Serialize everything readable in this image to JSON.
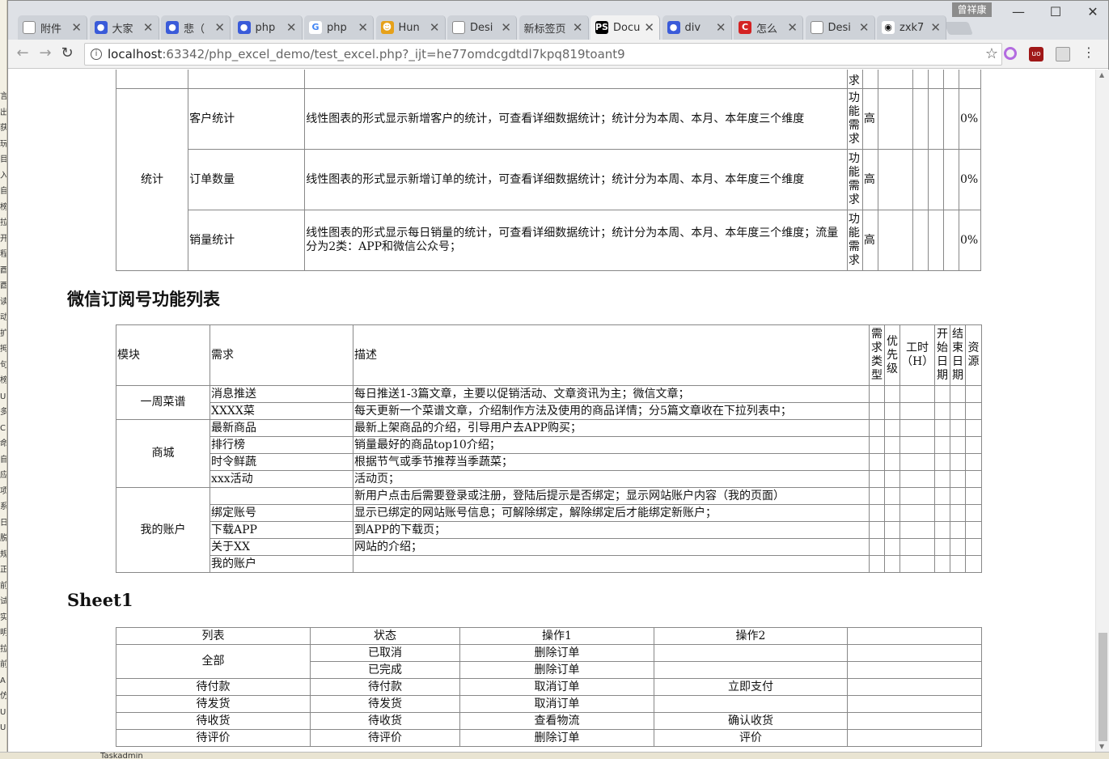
{
  "browser": {
    "user": "曾祥康",
    "tabs": [
      {
        "title": "附件",
        "icon": "file-icon"
      },
      {
        "title": "大家",
        "icon": "paw-icon"
      },
      {
        "title": "悲（",
        "icon": "paw-icon"
      },
      {
        "title": "php",
        "icon": "paw-icon"
      },
      {
        "title": "php",
        "icon": "google-icon"
      },
      {
        "title": "Hun",
        "icon": "hun-icon"
      },
      {
        "title": "Desi",
        "icon": "file-icon"
      },
      {
        "title": "新标签页",
        "icon": "none"
      },
      {
        "title": "Docu",
        "icon": "phpstorm-icon",
        "active": true
      },
      {
        "title": "div",
        "icon": "paw-icon"
      },
      {
        "title": "怎么",
        "icon": "c-icon"
      },
      {
        "title": "Desi",
        "icon": "file-icon"
      },
      {
        "title": "zxk7",
        "icon": "github-icon"
      }
    ],
    "url_host": "localhost",
    "url_path": ":63342/php_excel_demo/test_excel.php?_ijt=he77omdcgdtdl7kpq819toant9"
  },
  "left_strip": [
    "言",
    "出",
    "获",
    "玩",
    "目",
    "入",
    "自",
    "榜",
    "拉",
    "开",
    "程",
    "酉",
    "酉",
    "读",
    "动",
    "扩",
    "拇",
    "句",
    "榜",
    "U",
    "多",
    "C",
    "命",
    "自",
    "应",
    "项",
    "系",
    "日",
    "脱",
    "规",
    "正",
    "前",
    "试",
    "实",
    "明",
    "拉",
    "前",
    "A",
    "仿",
    "U",
    "U"
  ],
  "bottom_text": "Taskadmin",
  "table1": {
    "top_cell_text": "求",
    "group": "统计",
    "rows": [
      {
        "need": "客户统计",
        "desc": "线性图表的形式显示新增客户的统计，可查看详细数据统计；统计分为本周、本月、本年度三个维度",
        "type": "功能需求",
        "priority": "高",
        "progress": "0%"
      },
      {
        "need": "订单数量",
        "desc": "线性图表的形式显示新增订单的统计，可查看详细数据统计；统计分为本周、本月、本年度三个维度",
        "type": "功能需求",
        "priority": "高",
        "progress": "0%"
      },
      {
        "need": "销量统计",
        "desc": "线性图表的形式显示每日销量的统计，可查看详细数据统计；统计分为本周、本月、本年度三个维度；流量分为2类：APP和微信公众号；",
        "type": "功能需求",
        "priority": "高",
        "progress": "0%"
      }
    ]
  },
  "table2": {
    "title": "微信订阅号功能列表",
    "headers": {
      "module": "模块",
      "need": "需求",
      "desc": "描述",
      "type": "需求类型",
      "priority": "优先级",
      "hours": "工时（H）",
      "start": "开始日期",
      "end": "结束日期",
      "resource": "资源"
    },
    "groups": [
      {
        "module": "一周菜谱",
        "rows": [
          {
            "need": "消息推送",
            "desc": "每日推送1-3篇文章，主要以促销活动、文章资讯为主；微信文章；"
          },
          {
            "need": "XXXX菜",
            "desc": "每天更新一个菜谱文章，介绍制作方法及使用的商品详情；分5篇文章收在下拉列表中；"
          }
        ]
      },
      {
        "module": "商城",
        "rows": [
          {
            "need": "最新商品",
            "desc": "最新上架商品的介绍，引导用户去APP购买；"
          },
          {
            "need": "排行榜",
            "desc": "销量最好的商品top10介绍；"
          },
          {
            "need": "时令鲜蔬",
            "desc": "根据节气或季节推荐当季蔬菜；"
          },
          {
            "need": "xxx活动",
            "desc": "活动页；"
          }
        ]
      },
      {
        "module": "我的账户",
        "rows": [
          {
            "need": "",
            "desc": "新用户点击后需要登录或注册，登陆后提示是否绑定；显示网站账户内容（我的页面）"
          },
          {
            "need": "绑定账号",
            "desc": "显示已绑定的网站账号信息；可解除绑定，解除绑定后才能绑定新账户；"
          },
          {
            "need": "下载APP",
            "desc": "到APP的下载页；"
          },
          {
            "need": "关于XX",
            "desc": "网站的介绍；"
          },
          {
            "need": "我的账户",
            "desc": ""
          }
        ]
      }
    ]
  },
  "table3": {
    "title": "Sheet1",
    "headers": [
      "列表",
      "状态",
      "操作1",
      "操作2",
      ""
    ],
    "rows": [
      [
        "全部",
        "已取消",
        "删除订单",
        ""
      ],
      [
        "",
        "已完成",
        "删除订单",
        ""
      ],
      [
        "待付款",
        "待付款",
        "取消订单",
        "立即支付"
      ],
      [
        "待发货",
        "待发货",
        "取消订单",
        ""
      ],
      [
        "待收货",
        "待收货",
        "查看物流",
        "确认收货"
      ],
      [
        "待评价",
        "待评价",
        "删除订单",
        "评价"
      ]
    ]
  }
}
